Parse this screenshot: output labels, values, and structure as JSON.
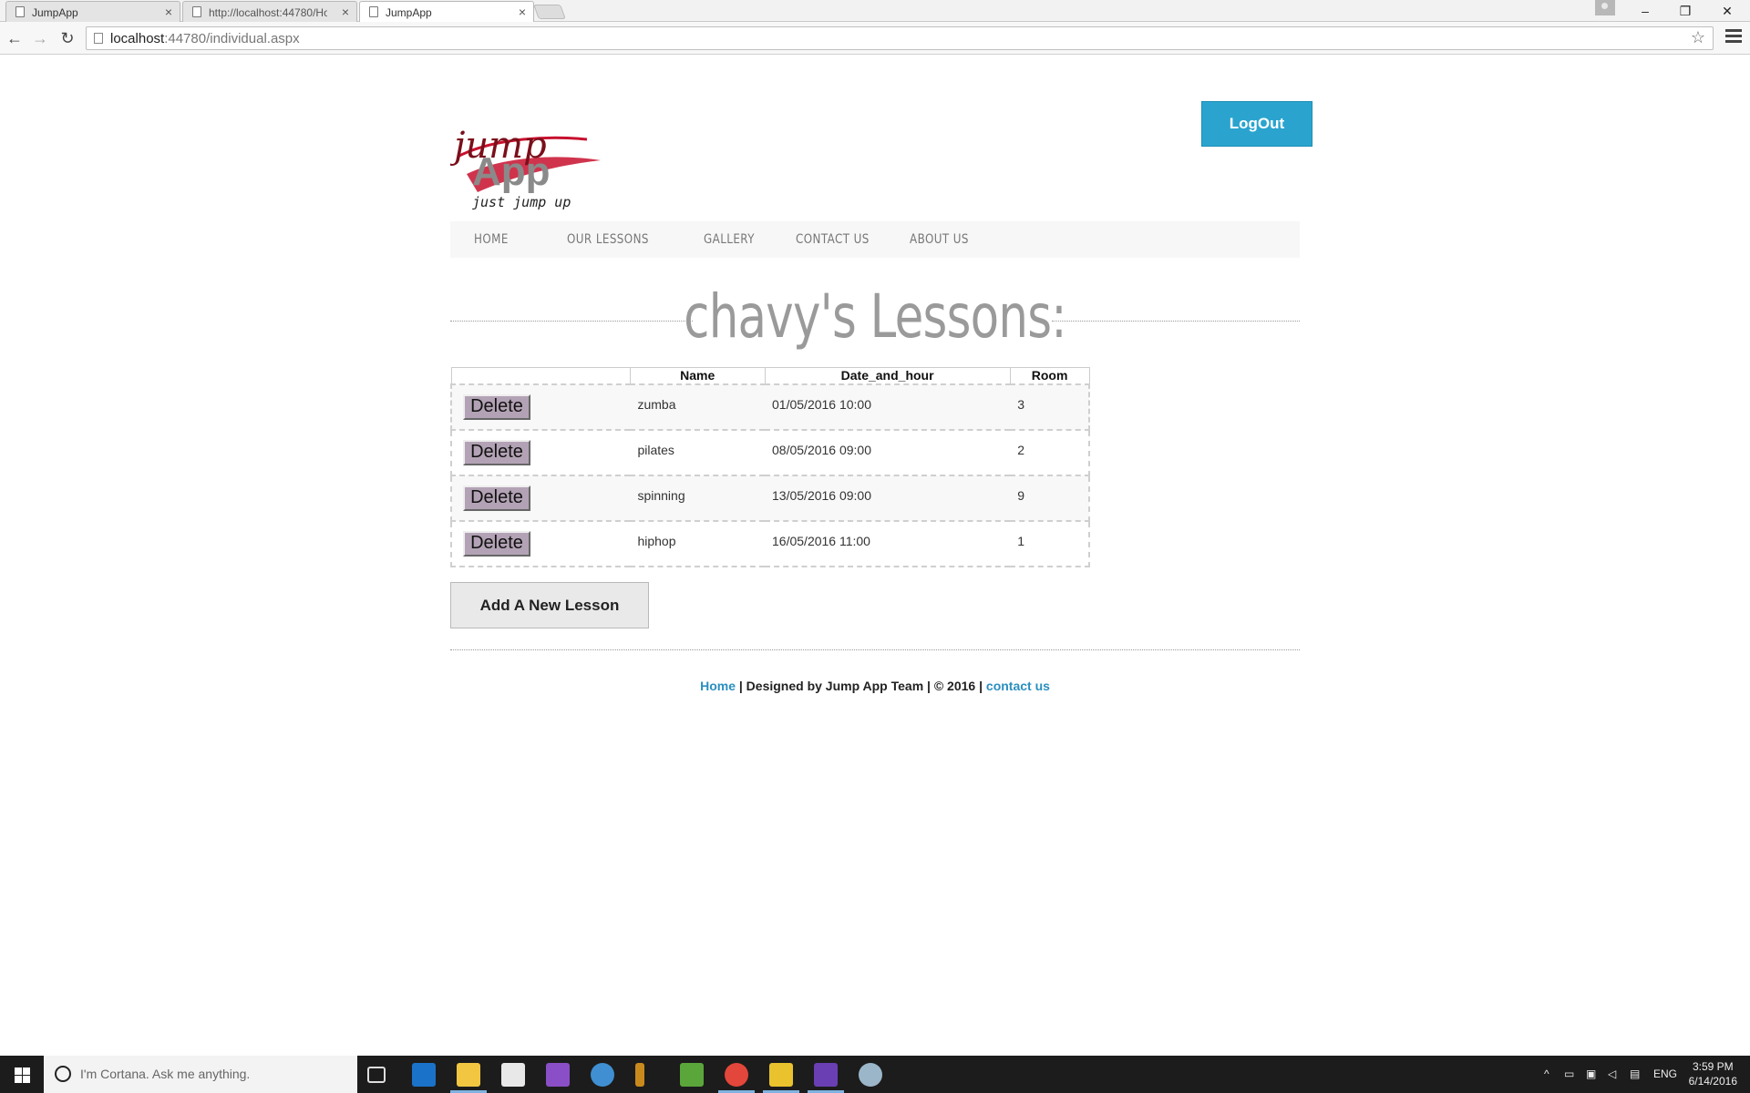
{
  "browser": {
    "tabs": [
      {
        "title": "JumpApp",
        "active": false
      },
      {
        "title": "http://localhost:44780/Ho",
        "active": false
      },
      {
        "title": "JumpApp",
        "active": true
      }
    ],
    "url_host": "localhost",
    "url_rest": ":44780/individual.aspx"
  },
  "header": {
    "logo_top": "jump",
    "logo_mid": "App",
    "logo_tagline": "just jump up",
    "logout_label": "LogOut"
  },
  "nav": {
    "items": [
      "HOME",
      "OUR LESSONS",
      "GALLERY",
      "CONTACT US",
      "ABOUT US"
    ]
  },
  "main": {
    "heading": "chavy's Lessons:",
    "table": {
      "columns": [
        "",
        "Name",
        "Date_and_hour",
        "Room"
      ],
      "delete_label": "Delete",
      "rows": [
        {
          "name": "zumba",
          "date": "01/05/2016 10:00",
          "room": "3"
        },
        {
          "name": "pilates",
          "date": "08/05/2016 09:00",
          "room": "2"
        },
        {
          "name": "spinning",
          "date": "13/05/2016 09:00",
          "room": "9"
        },
        {
          "name": "hiphop",
          "date": "16/05/2016 11:00",
          "room": "1"
        }
      ]
    },
    "add_button": "Add A New Lesson"
  },
  "footer": {
    "home_link": "Home",
    "text": " | Designed by Jump App Team | © 2016 | ",
    "contact_link": "contact us"
  },
  "taskbar": {
    "cortana_placeholder": "I'm Cortana. Ask me anything.",
    "language": "ENG",
    "time": "3:59 PM",
    "date": "6/14/2016"
  },
  "colors": {
    "logout_bg": "#2aa4cf",
    "link": "#2a8fbf",
    "delete_bg": "#b3a2b5",
    "logo_red": "#c8102e"
  }
}
